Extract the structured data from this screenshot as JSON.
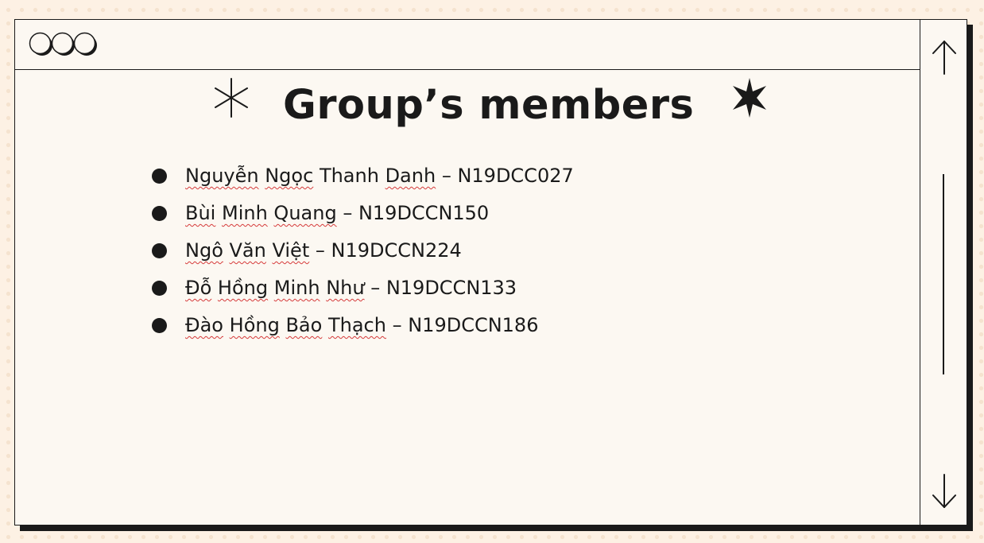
{
  "window": {
    "title": "Group’s members",
    "controls": [
      "circle-button-1",
      "circle-button-2",
      "circle-button-3"
    ]
  },
  "scrollbar": {
    "up_icon": "arrow-up-icon",
    "down_icon": "arrow-down-icon"
  },
  "decorations": {
    "left": "asterisk-sparkle-icon",
    "right": "star-sparkle-icon"
  },
  "members": [
    {
      "name_parts": [
        "Nguyễn",
        "Ngọc",
        "Thanh",
        "Danh"
      ],
      "name_flagged": [
        true,
        true,
        false,
        true
      ],
      "separator": " – ",
      "id": "N19DCC027"
    },
    {
      "name_parts": [
        "Bùi",
        "Minh",
        "Quang"
      ],
      "name_flagged": [
        true,
        true,
        true
      ],
      "separator": " – ",
      "id": "N19DCCN150"
    },
    {
      "name_parts": [
        "Ngô",
        "Văn",
        "Việt"
      ],
      "name_flagged": [
        true,
        true,
        true
      ],
      "separator": " – ",
      "id": "N19DCCN224"
    },
    {
      "name_parts": [
        "Đỗ",
        "Hồng",
        "Minh",
        "Như"
      ],
      "name_flagged": [
        true,
        true,
        true,
        true
      ],
      "separator": " – ",
      "id": "N19DCCN133"
    },
    {
      "name_parts": [
        "Đào",
        "Hồng",
        "Bảo",
        "Thạch"
      ],
      "name_flagged": [
        true,
        true,
        true,
        true
      ],
      "separator": " – ",
      "id": "N19DCCN186"
    }
  ],
  "colors": {
    "background": "#fdf1e4",
    "window": "#fcf8f2",
    "ink": "#1a1a1a",
    "spellcheck": "#d63a3a"
  }
}
